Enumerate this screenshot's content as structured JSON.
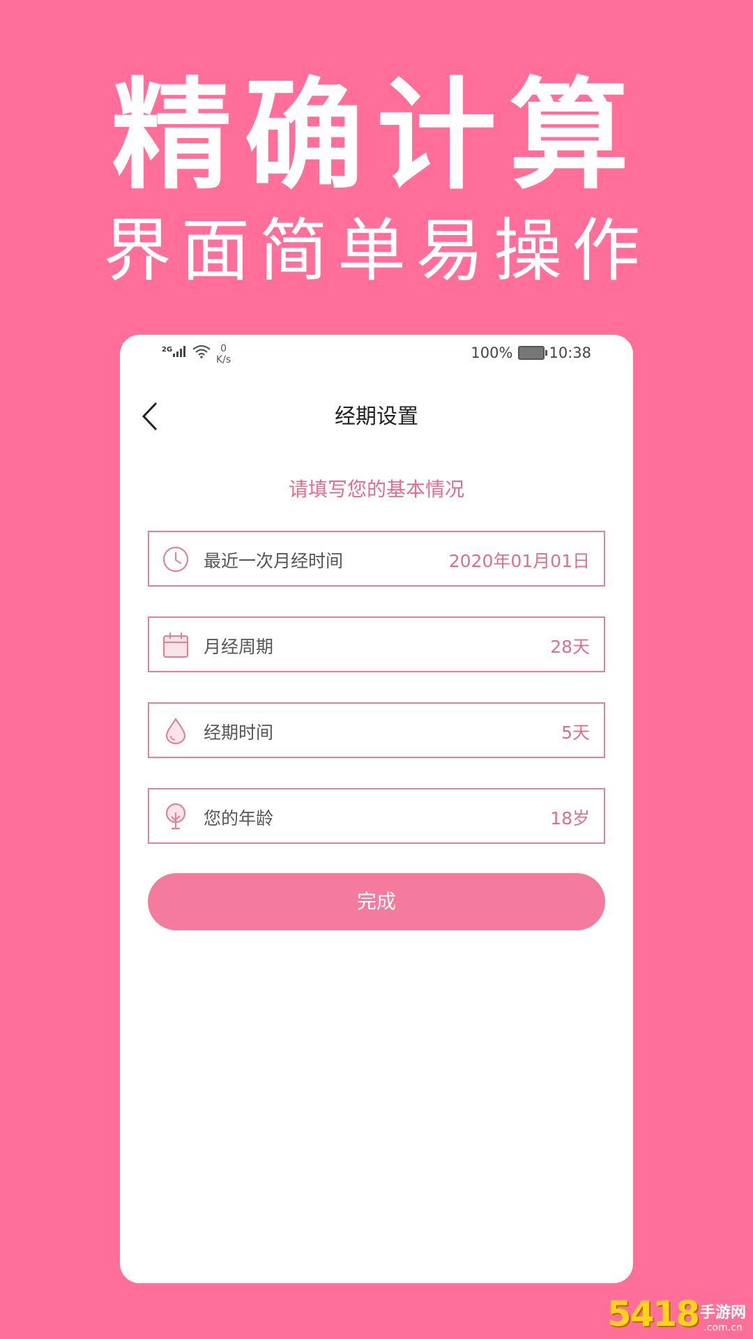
{
  "promo": {
    "headline": "精确计算",
    "subheadline": "界面简单易操作"
  },
  "status_bar": {
    "network": "2G",
    "speed_value": "0",
    "speed_unit": "K/s",
    "battery": "100%",
    "time": "10:38"
  },
  "nav": {
    "title": "经期设置"
  },
  "form": {
    "heading": "请填写您的基本情况",
    "fields": [
      {
        "icon": "clock-icon",
        "label": "最近一次月经时间",
        "value": "2020年01月01日"
      },
      {
        "icon": "calendar-icon",
        "label": "月经周期",
        "value": "28天"
      },
      {
        "icon": "drop-icon",
        "label": "经期时间",
        "value": "5天"
      },
      {
        "icon": "tree-icon",
        "label": "您的年龄",
        "value": "18岁"
      }
    ],
    "submit_label": "完成"
  },
  "watermark": {
    "number": "5418",
    "cn": "手游网",
    "url": ".com.cn"
  },
  "colors": {
    "background": "#FF6F99",
    "accent": "#D9708E",
    "button": "#F47A9E"
  }
}
